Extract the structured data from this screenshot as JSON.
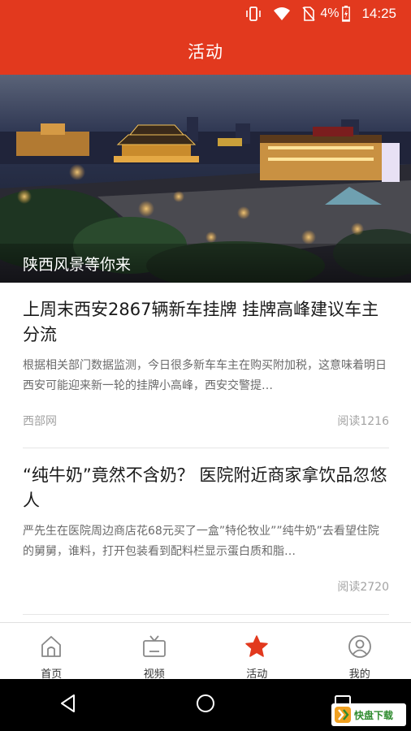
{
  "status_bar": {
    "battery_percent": "4%",
    "time": "14:25",
    "icons": [
      "vibrate-icon",
      "wifi-icon",
      "no-sim-icon",
      "battery-charging-icon"
    ]
  },
  "header": {
    "title": "活动"
  },
  "banner": {
    "caption": "陕西风景等你来"
  },
  "articles": [
    {
      "title": "上周末西安2867辆新车挂牌 挂牌高峰建议车主分流",
      "summary": "根据相关部门数据监测，今日很多新车车主在购买附加税，这意味着明日西安可能迎来新一轮的挂牌小高峰，西安交警提…",
      "source": "西部网",
      "reads": "阅读1216"
    },
    {
      "title": "“纯牛奶”竟然不含奶？ 医院附近商家拿饮品忽悠人",
      "summary": "严先生在医院周边商店花68元买了一盒”特伦牧业””纯牛奶”去看望住院的舅舅，谁料，打开包装看到配料栏显示蛋白质和脂…",
      "source": "",
      "reads": "阅读2720"
    }
  ],
  "tabs": [
    {
      "label": "首页",
      "icon": "home-icon",
      "active": false
    },
    {
      "label": "视频",
      "icon": "tv-icon",
      "active": false
    },
    {
      "label": "活动",
      "icon": "star-icon",
      "active": true
    },
    {
      "label": "我的",
      "icon": "user-icon",
      "active": false
    }
  ],
  "nav_bar": {
    "icons": [
      "back-icon",
      "home-circle-icon",
      "recents-icon"
    ]
  },
  "watermark": {
    "text": "快盘下载"
  },
  "colors": {
    "brand_red": "#e2391e",
    "text_gray": "#6a6a6a",
    "meta_gray": "#a3a3a3"
  }
}
